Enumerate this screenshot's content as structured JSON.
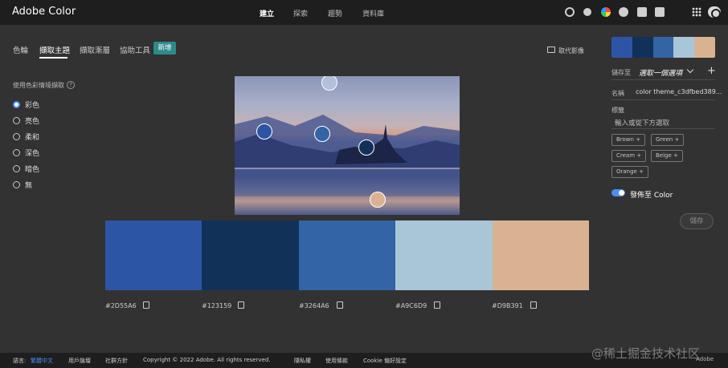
{
  "app": {
    "title": "Adobe Color"
  },
  "topnav": [
    {
      "label": "建立",
      "active": true
    },
    {
      "label": "探索",
      "active": false
    },
    {
      "label": "趨勢",
      "active": false
    },
    {
      "label": "資料庫",
      "active": false
    }
  ],
  "header_icons": [
    "color-settings-icon",
    "theme-icon",
    "color-wheel-icon",
    "help-icon",
    "feedback-icon",
    "chat-icon",
    "apps-grid-icon",
    "creative-cloud-icon"
  ],
  "tabs": [
    {
      "label": "色輪",
      "active": false
    },
    {
      "label": "擷取主題",
      "active": true
    },
    {
      "label": "擷取漸層",
      "active": false
    },
    {
      "label": "協助工具",
      "active": false
    }
  ],
  "tab_badge": "新增",
  "replace_image": "取代影像",
  "mood": {
    "title": "使用色彩情境擷取",
    "selected": "彩色",
    "options": [
      "彩色",
      "亮色",
      "柔和",
      "深色",
      "暗色",
      "無"
    ]
  },
  "palette": [
    {
      "hex": "#2D55A6",
      "color": "#2d55a6"
    },
    {
      "hex": "#123159",
      "color": "#123159"
    },
    {
      "hex": "#3264A6",
      "color": "#3264a6"
    },
    {
      "hex": "#A9C6D9",
      "color": "#a9c6d9"
    },
    {
      "hex": "#D9B391",
      "color": "#d9b391"
    }
  ],
  "right_panel": {
    "save_to_label": "儲存至",
    "library_select": "選取一個選項",
    "name_label": "名稱",
    "name_value": "color theme_c3dfbed389...",
    "tags_label": "標籤",
    "tags_placeholder": "輸入或從下方選取",
    "tags": [
      "Brown",
      "Green",
      "Cream",
      "Beige",
      "Orange"
    ],
    "tag_add_symbol": "+",
    "publish_label": "發佈至 Color",
    "publish_enabled": true,
    "save_button": "儲存"
  },
  "footer": {
    "language_label": "語言:",
    "language_value": "繁體中文",
    "items": [
      "用戶論壇",
      "社群方針",
      "Copyright © 2022 Adobe. All rights reserved.",
      "隱私權",
      "使用條款",
      "Cookie 偏好設定"
    ],
    "brand": "Adobe"
  },
  "watermark": "@稀土掘金技术社区"
}
